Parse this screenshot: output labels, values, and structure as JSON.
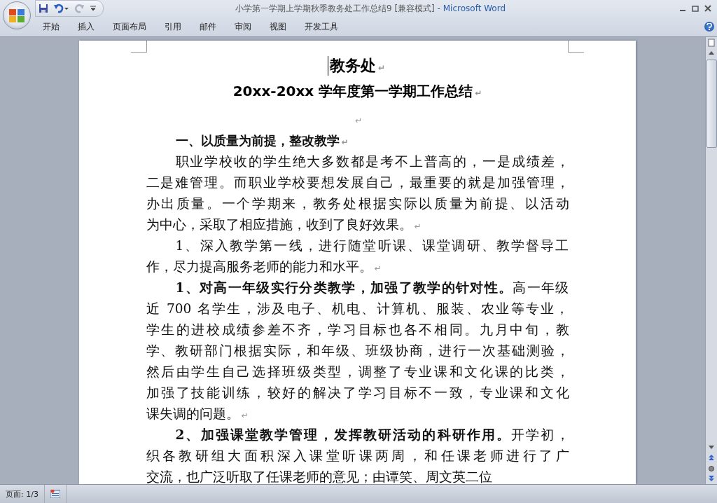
{
  "window": {
    "title": "小学第一学期上学期秋季教务处工作总结9 [兼容模式]",
    "app": " - Microsoft Word"
  },
  "quick_access": [
    {
      "kind": "save",
      "disabled": false
    },
    {
      "kind": "undo",
      "disabled": false
    },
    {
      "kind": "redo",
      "disabled": true
    }
  ],
  "ribbon_tabs": [
    {
      "label": "开始"
    },
    {
      "label": "插入"
    },
    {
      "label": "页面布局"
    },
    {
      "label": "引用"
    },
    {
      "label": "邮件"
    },
    {
      "label": "审阅"
    },
    {
      "label": "视图"
    },
    {
      "label": "开发工具"
    }
  ],
  "document": {
    "paragraph_mark": "↵",
    "titles": [
      "教务处",
      "20xx-20xx 学年度第一学期工作总结"
    ],
    "paragraphs": [
      {
        "kind": "blank"
      },
      {
        "kind": "heading",
        "lines": [
          "一、以质量为前提，整改教学"
        ]
      },
      {
        "kind": "body",
        "lines": [
          "职业学校收的学生绝大多数都是考不上普高的，一是成绩差，",
          "二是难管理。而职业学校要想发展自己，最重要的就是加强管理，",
          "办出质量。一个学期来，教务处根据实际以质量为前提、以活动",
          "为中心，采取了相应措施，收到了良好效果。"
        ]
      },
      {
        "kind": "body",
        "lines": [
          "1、深入教学第一线，进行随堂听课、课堂调研、教学督导工",
          "作，尽力提高服务老师的能力和水平。"
        ]
      },
      {
        "kind": "body",
        "lines": [
          "**1、对高一年级实行分类教学，加强了教学的针对性。**高一年级",
          "近 700 名学生，涉及电子、机电、计算机、服装、农业等专业，",
          "学生的进校成绩参差不齐，学习目标也各不相同。九月中旬，教",
          "学、教研部门根据实际，和年级、班级协商，进行一次基础测验，",
          "然后由学生自己选择班级类型，调整了专业课和文化课的比类，",
          "加强了技能训练，较好的解决了学习目标不一致，专业课和文化",
          "课失调的问题。"
        ]
      },
      {
        "kind": "cut",
        "lines": [
          "**2、加强课堂教学管理，发挥教研活动的科研作用。**开学初，",
          "织各教研组大面积深入课堂听课两周，和任课老师进行了广",
          "交流，也广泛听取了任课老师的意见；由谭笑、周文英二位"
        ]
      }
    ]
  },
  "status_bar": {
    "page": "页面: 1/3"
  }
}
